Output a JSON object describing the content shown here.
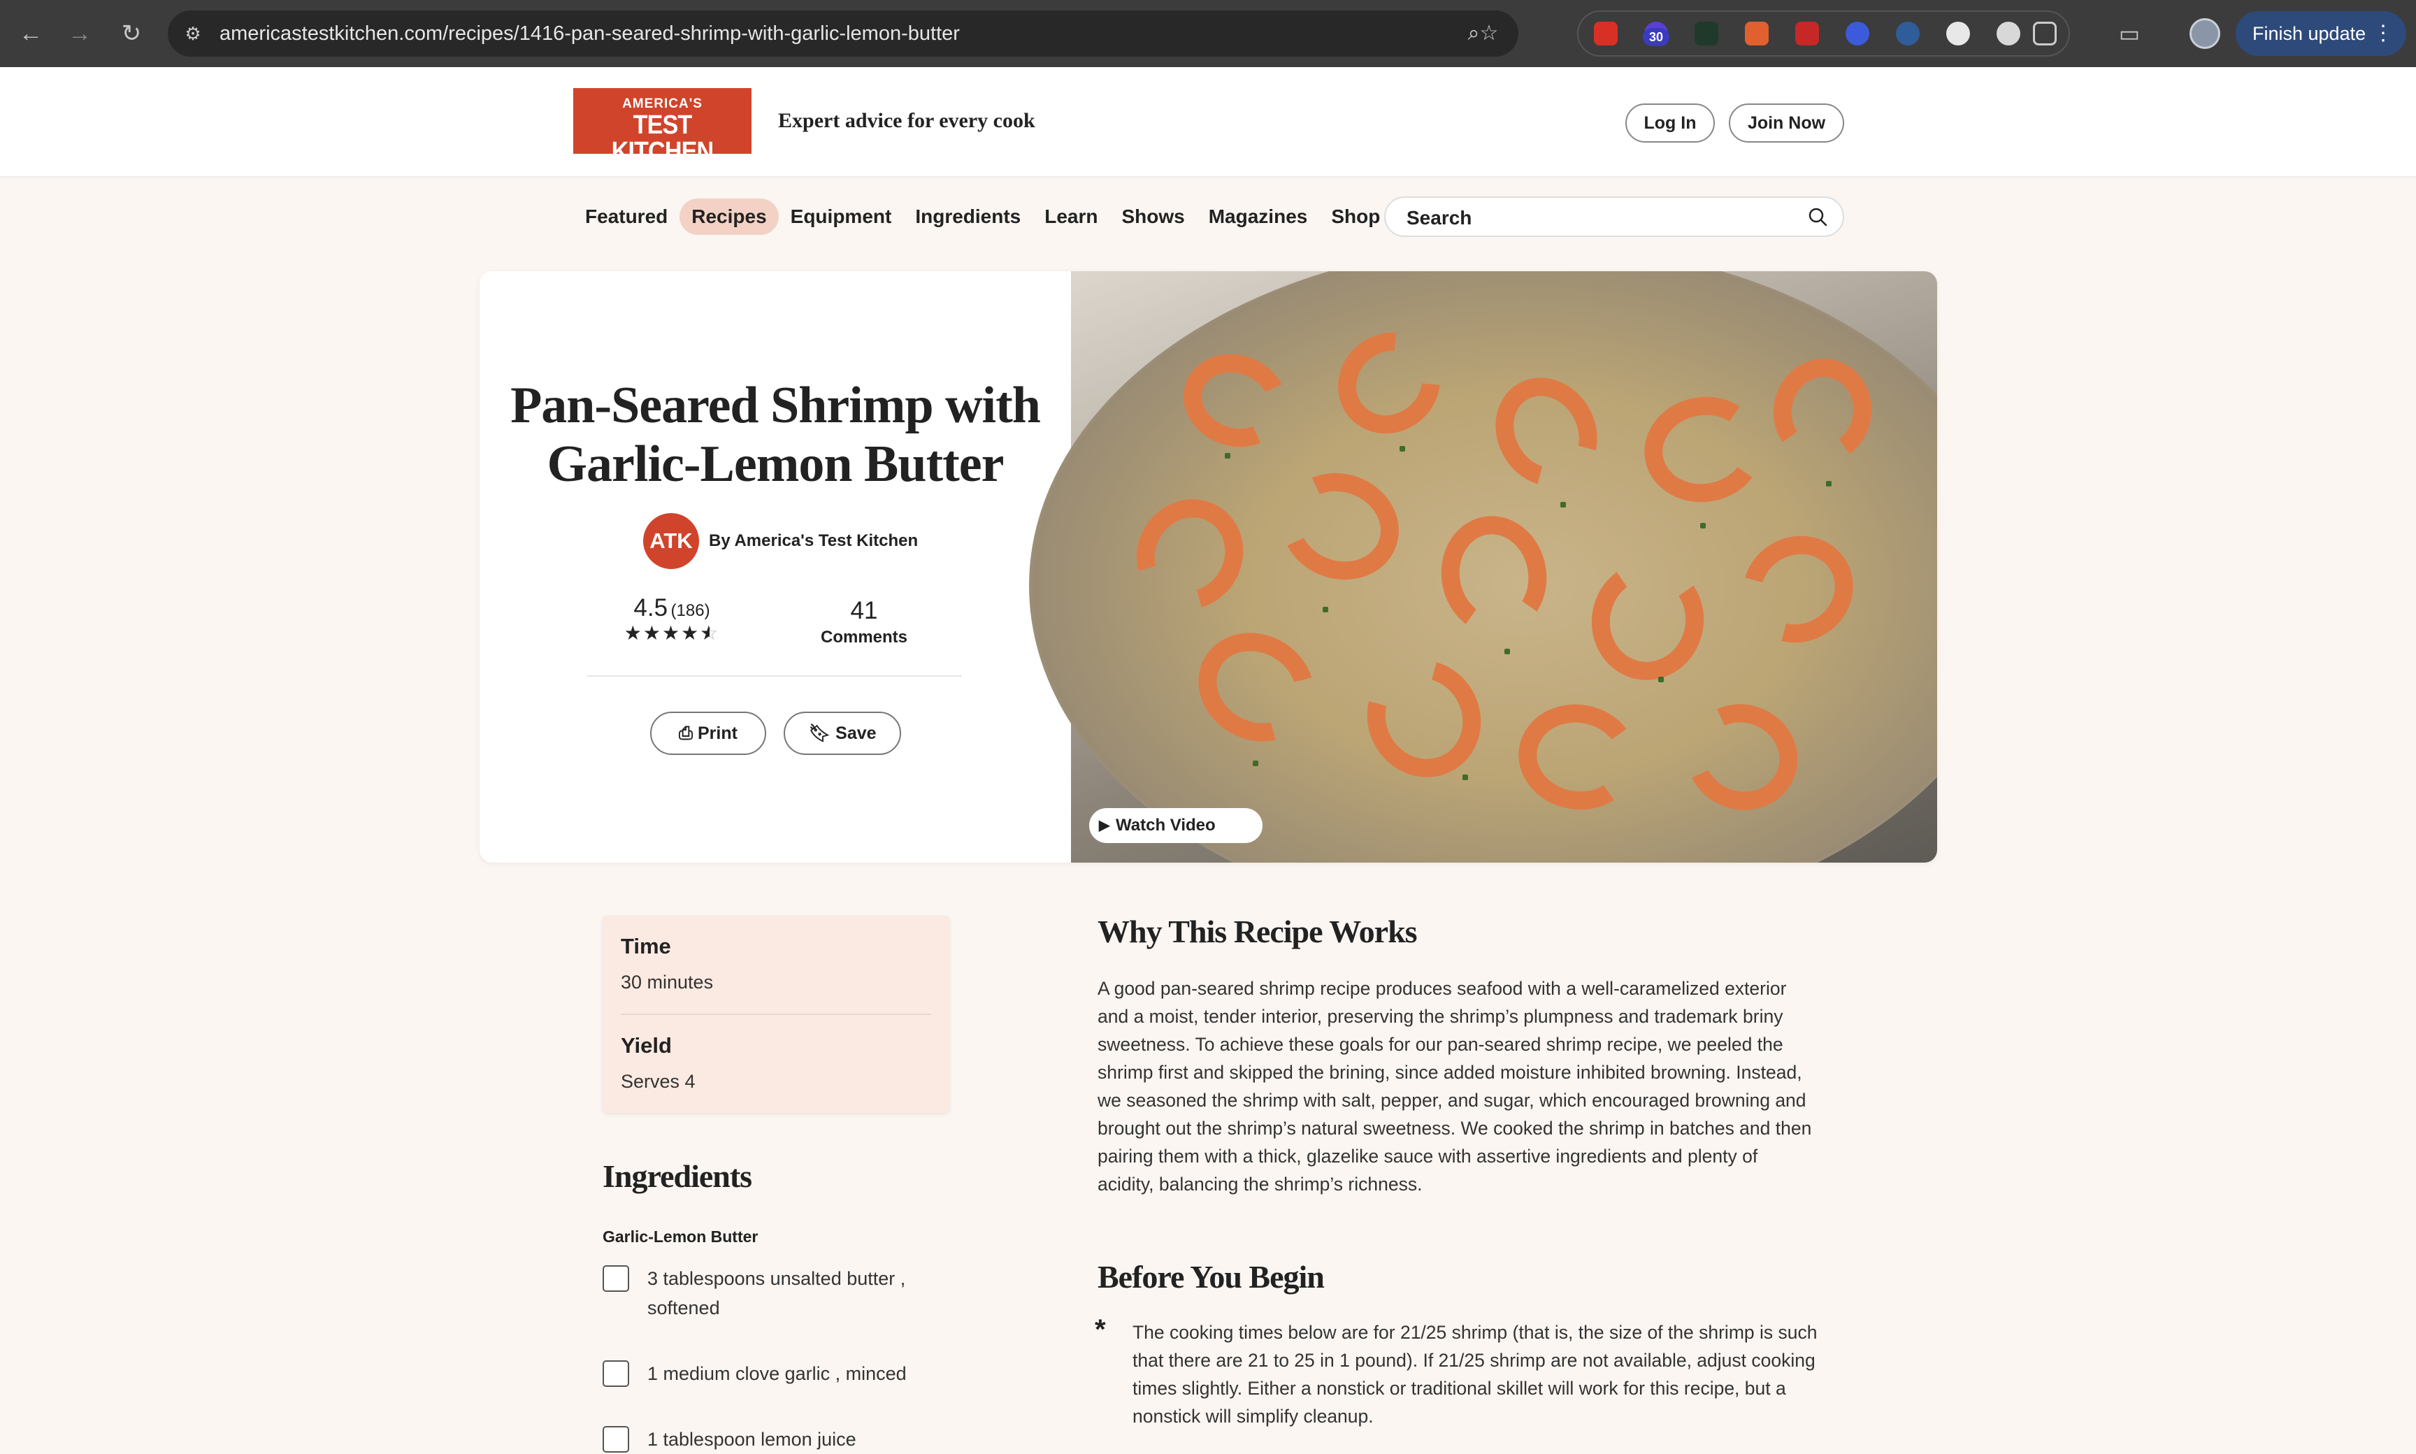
{
  "browser": {
    "url": "americastestkitchen.com/recipes/1416-pan-seared-shrimp-with-garlic-lemon-butter",
    "ext_badge": "30",
    "update_label": "Finish update",
    "ext_colors": [
      "#d93025",
      "#5b3fd6",
      "#1f8f55",
      "#e0612f",
      "#c62828",
      "#3b5bdb",
      "#4a7ec7",
      "#e0e0e0",
      "#e0e0e0"
    ]
  },
  "header": {
    "logo_top": "AMERICA'S",
    "logo_main": "TEST KITCHEN",
    "tagline": "Expert advice for every cook",
    "login_label": "Log In",
    "join_label": "Join Now",
    "brand_color": "#d0442b"
  },
  "nav": {
    "items": [
      "Featured",
      "Recipes",
      "Equipment",
      "Ingredients",
      "Learn",
      "Shows",
      "Magazines",
      "Shop"
    ],
    "active": "Recipes",
    "search_placeholder": "Search"
  },
  "recipe": {
    "title_line1": "Pan-Seared Shrimp with",
    "title_line2": "Garlic-Lemon Butter",
    "avatar_text": "ATK",
    "author": "By America's Test Kitchen",
    "rating": "4.5",
    "rating_count": "(186)",
    "stars_value": 4.5,
    "comments_count": "41",
    "comments_label": "Comments",
    "print_label": "Print",
    "save_label": "Save",
    "watch_label": "Watch Video"
  },
  "info": {
    "time_label": "Time",
    "time_value": "30 minutes",
    "yield_label": "Yield",
    "yield_value": "Serves 4"
  },
  "ingredients": {
    "heading": "Ingredients",
    "subheading": "Garlic-Lemon Butter",
    "items": [
      "3 tablespoons unsalted butter , softened",
      "1 medium clove garlic , minced",
      "1 tablespoon lemon juice"
    ]
  },
  "why": {
    "heading": "Why This Recipe Works",
    "body": "A good pan-seared shrimp recipe produces seafood with a well-caramelized exterior and a moist, tender interior, preserving the shrimp’s plumpness and trademark briny sweetness. To achieve these goals for our pan-seared shrimp recipe, we peeled the shrimp first and skipped the brining, since added moisture inhibited browning. Instead, we seasoned the shrimp with salt, pepper, and sugar, which encouraged browning and brought out the shrimp’s natural sweetness. We cooked the shrimp in batches and then pairing them with a thick, glazelike sauce with assertive ingredients and plenty of acidity, balancing the shrimp’s richness."
  },
  "before": {
    "heading": "Before You Begin",
    "bullet": "*",
    "body": "The cooking times below are for 21/25 shrimp (that is, the size of the shrimp is such that there are 21 to 25 in 1 pound). If 21/25 shrimp are not available, adjust cooking times slightly. Either a nonstick or traditional skillet will work for this recipe, but a nonstick will simplify cleanup."
  }
}
